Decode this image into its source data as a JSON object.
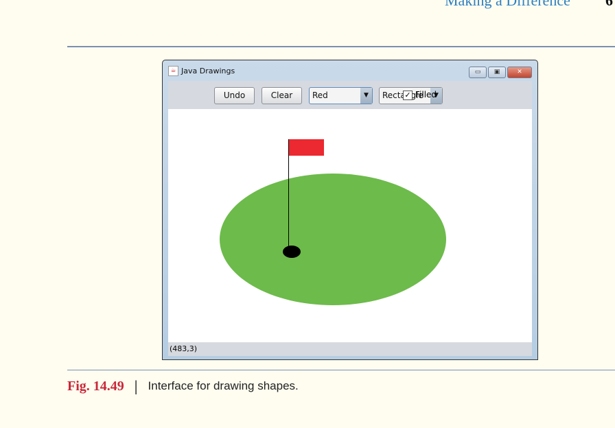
{
  "page": {
    "running_header": "Making a Difference",
    "page_number": "6"
  },
  "window": {
    "title": "Java Drawings",
    "controls": {
      "minimize": "minimize-icon",
      "maximize": "maximize-icon",
      "close": "close-icon"
    },
    "toolbar": {
      "undo_label": "Undo",
      "clear_label": "Clear",
      "color_selected": "Red",
      "shape_selected": "Rectangle",
      "filled_label": "Filled",
      "filled_checked": true
    },
    "drawing": {
      "colors": {
        "green": "#6dbb4b",
        "red": "#ec2830",
        "black": "#000000"
      }
    },
    "status": "(483,3)"
  },
  "caption": {
    "label": "Fig. 14.49",
    "separator": "|",
    "text": "Interface for drawing shapes."
  }
}
